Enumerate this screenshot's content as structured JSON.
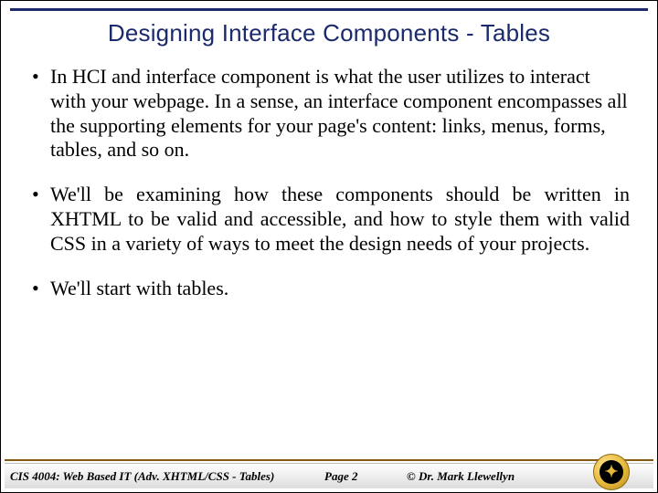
{
  "title": "Designing Interface Components - Tables",
  "bullets": [
    "In HCI and interface component is what the user utilizes to interact with your webpage.  In a sense, an interface component encompasses all the supporting elements for your page's content:  links, menus, forms, tables, and so on.",
    "We'll be examining how these components should be written in XHTML to be valid and accessible, and how to style them with valid CSS in a variety of ways to meet the design needs of your projects.",
    "We'll start with tables."
  ],
  "footer": {
    "course": "CIS 4004: Web Based IT (Adv. XHTML/CSS - Tables)",
    "page": "Page 2",
    "copyright": "© Dr. Mark Llewellyn"
  }
}
